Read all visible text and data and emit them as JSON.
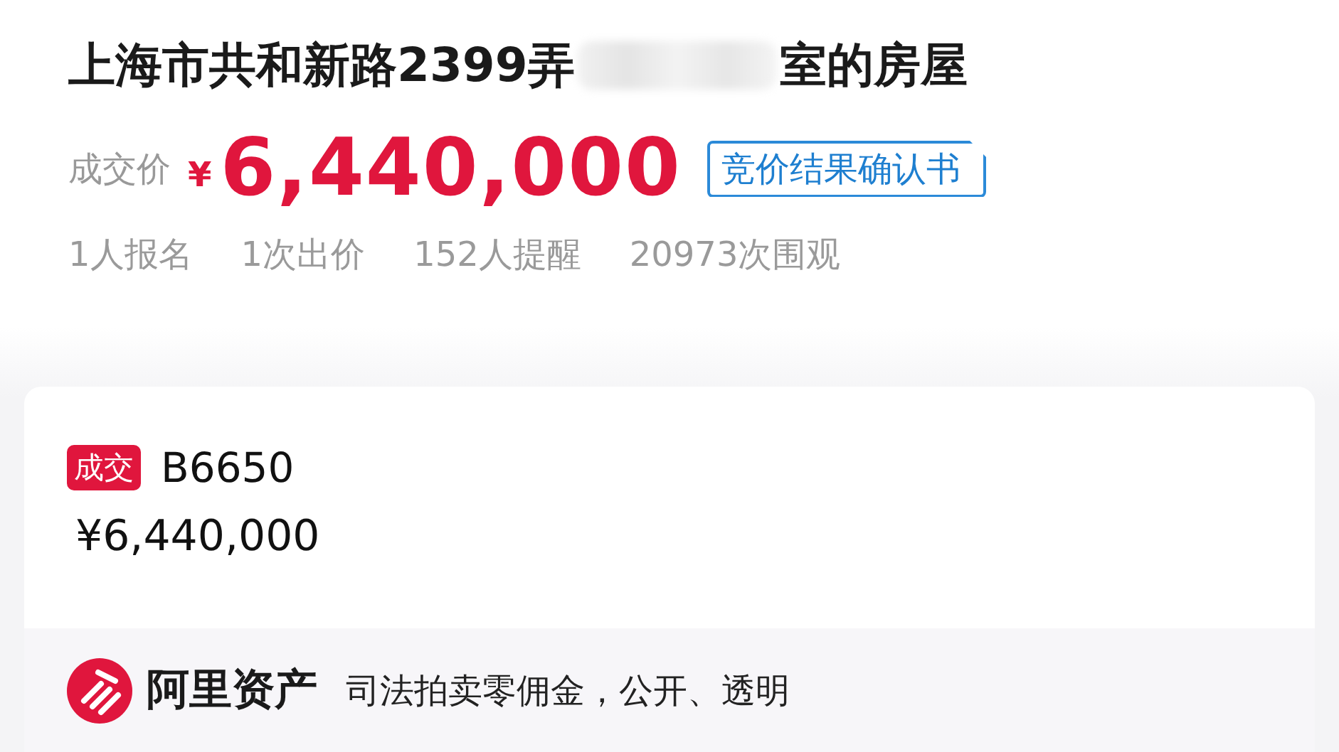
{
  "title": {
    "before": "上海市共和新路2399弄",
    "after": "室的房屋",
    "redacted": true
  },
  "price": {
    "label": "成交价",
    "currency": "¥",
    "amount": "6,440,000",
    "document_link": "竞价结果确认书"
  },
  "stats": [
    "1人报名",
    "1次出价",
    "152人提醒",
    "20973次围观"
  ],
  "bid": {
    "badge": "成交",
    "bidder": "B6650",
    "amount": "¥6,440,000"
  },
  "footer": {
    "brand": "阿里资产",
    "slogan": "司法拍卖零佣金，公开、透明"
  }
}
